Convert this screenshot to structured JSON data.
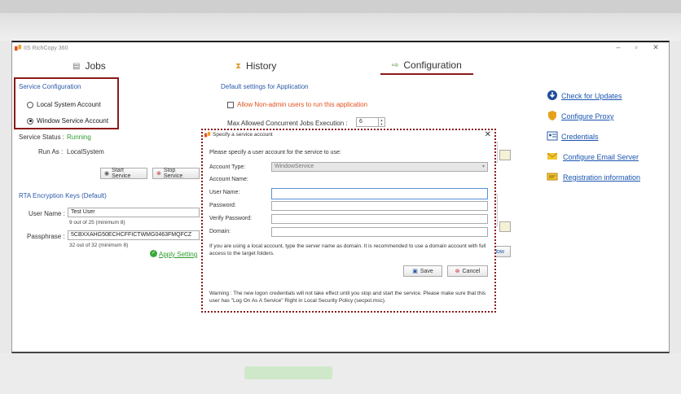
{
  "app": {
    "title": "IIS RichCopy 360"
  },
  "tabs": [
    {
      "label": "Jobs",
      "icon": "jobs-icon"
    },
    {
      "label": "History",
      "icon": "history-icon"
    },
    {
      "label": "Configuration",
      "icon": "configuration-icon",
      "active": true
    }
  ],
  "service_config": {
    "title": "Service Configuration",
    "options": [
      "Local System Account",
      "Window Service Account"
    ],
    "selected": "Window Service Account",
    "status_label": "Service Status :",
    "status_value": "Running",
    "runas_label": "Run As :",
    "runas_value": "LocalSystem",
    "start_label": "Start Service",
    "stop_label": "Stop Service"
  },
  "rta": {
    "title": "RTA Encryption Keys (Default)",
    "username_label": "User Name :",
    "username_value": "Test User",
    "username_count": "9 out of 25 (minimum 8)",
    "passphrase_label": "Passphrase :",
    "passphrase_value": "5CBXXAHG50ECHCFFICTWMG0463FMQFCZ",
    "passphrase_count": "32 out of 32 (minimum 8)",
    "apply_label": "Apply Setting"
  },
  "defaults": {
    "title": "Default settings for Application",
    "allow_nonadmin": "Allow Non-admin users to run this application",
    "max_jobs_label": "Max Allowed Concurrent Jobs Execution :",
    "max_jobs_value": "6",
    "now_label": "Now"
  },
  "links": [
    {
      "label": "Check for Updates",
      "icon": "update-icon"
    },
    {
      "label": "Configure Proxy",
      "icon": "shield-icon"
    },
    {
      "label": "Credentials",
      "icon": "credentials-icon"
    },
    {
      "label": "Configure Email Server",
      "icon": "email-icon"
    },
    {
      "label": "Registration information",
      "icon": "registration-icon"
    }
  ],
  "dialog": {
    "title": "Specify a service account",
    "prompt": "Please specify a user account for the service to use:",
    "account_type_label": "Account Type:",
    "account_type_value": "WindowService",
    "account_name_label": "Account Name:",
    "username_label": "User Name:",
    "password_label": "Password:",
    "verify_label": "Verify Password:",
    "domain_label": "Domain:",
    "note": "If you are using a local account, type the server name as domain. It is recommended to use a domain account with full access to the target folders.",
    "save_label": "Save",
    "cancel_label": "Cancel",
    "warning": "Warning : The new logon credentials will not take effect until you stop and start the service. Please make sure that this user has \"Log On As A Service\" Right in Local Security Policy (secpol.msc)."
  },
  "colors": {
    "accent": "#8b1a1a",
    "link": "#1a55b0",
    "running": "#2e9a2e",
    "warning_text": "#e2521e"
  }
}
